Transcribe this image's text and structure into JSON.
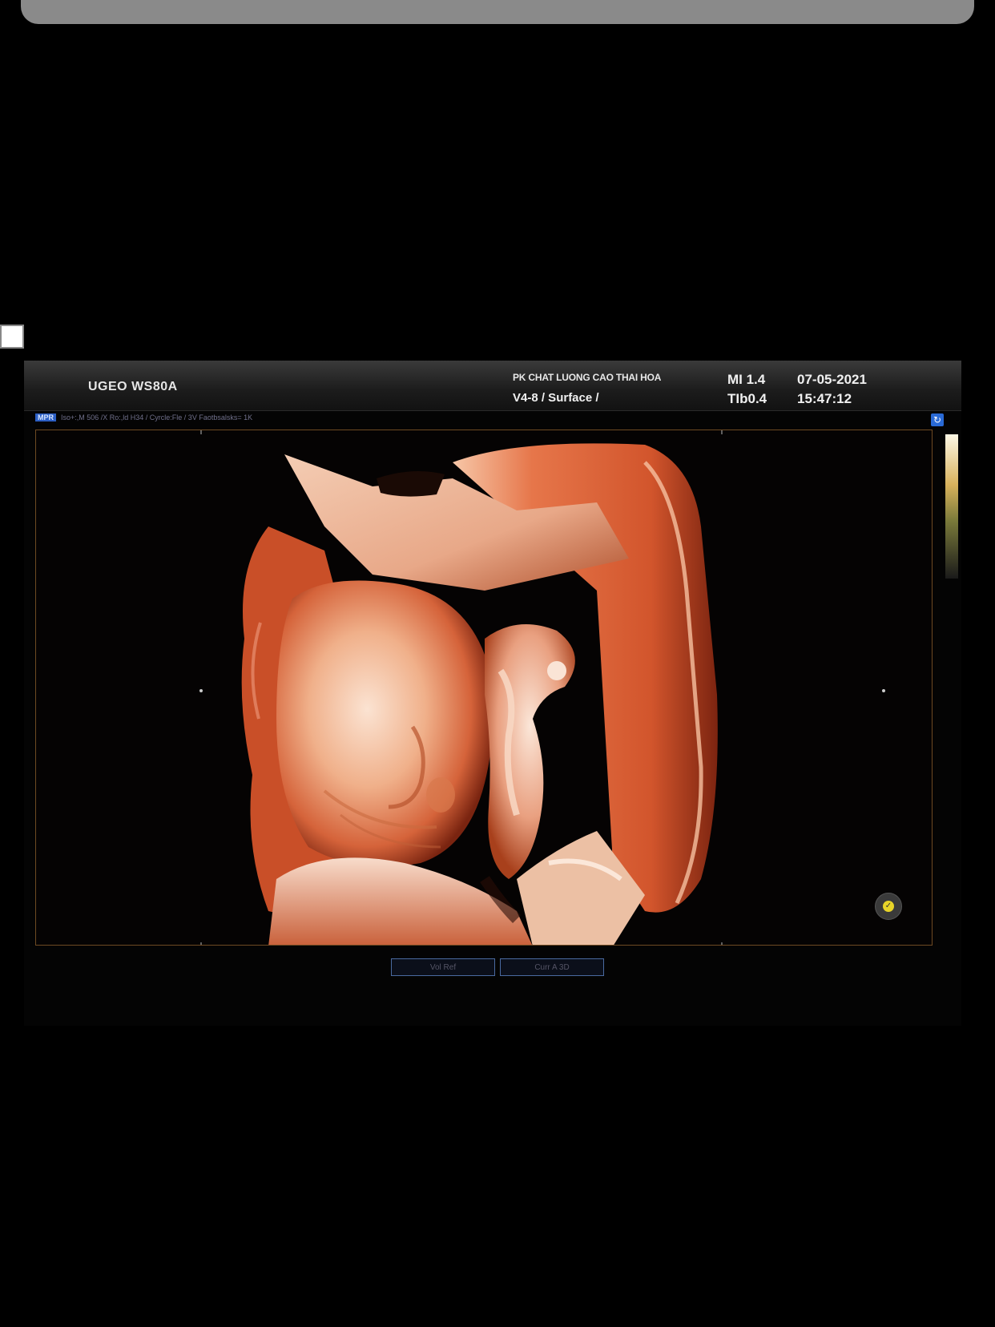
{
  "header": {
    "model": "UGEO WS80A",
    "clinic": "PK CHAT LUONG CAO THAI HOA",
    "mode": "V4-8 / Surface /",
    "mi": "MI  1.4",
    "tib": "TIb0.4",
    "date": "07-05-2021",
    "time": "15:47:12"
  },
  "params": {
    "tag": "MPR",
    "text": "Iso+:,M 506 /X Ro:,ld H34 / Cyrcle:Fle / 3V Faotbsalsks= 1K"
  },
  "tabs": [
    "Vol Ref",
    "Curr   A 3D"
  ],
  "colors": {
    "skin_light": "#f4c6a6",
    "skin_mid": "#d9693a",
    "skin_dark": "#8a2a10",
    "frame": "#6e4a22"
  },
  "icons": [
    "cycle-icon",
    "check-icon"
  ]
}
